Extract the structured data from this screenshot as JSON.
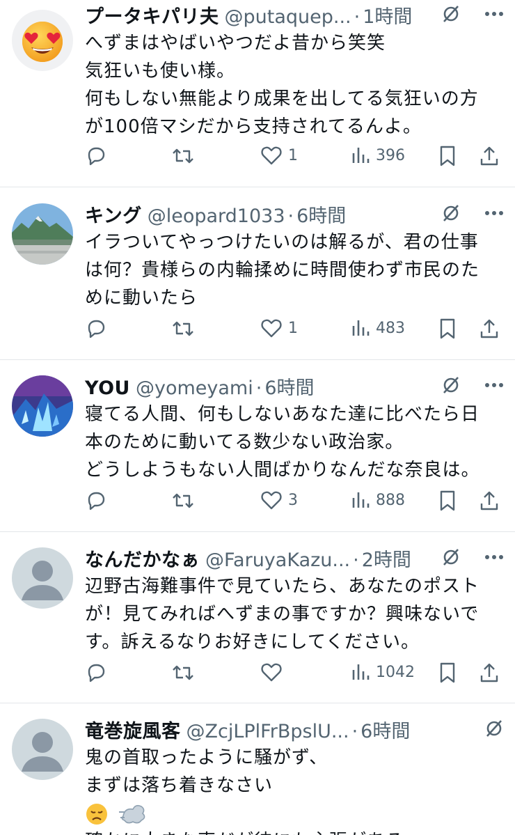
{
  "tweets": [
    {
      "name": "プータキパリ夫",
      "handle": "@putaquep...",
      "time": "1時間",
      "lines": [
        "へずまはやばいやつだよ昔から笑笑",
        "気狂いも使い様。",
        "何もしない無能より成果を出してる気狂いの方",
        "が100倍マシだから支持されてるんよ。"
      ],
      "likes": "1",
      "views": "396",
      "avatar": "heart-eyes-emoji"
    },
    {
      "name": "キング",
      "handle": "@leopard1033",
      "time": "6時間",
      "lines": [
        "イラついてやっつけたいのは解るが、君の仕事",
        "は何？貴様らの内輪揉めに時間使わず市民のた",
        "めに動いたら"
      ],
      "likes": "1",
      "views": "483",
      "avatar": "landscape-photo"
    },
    {
      "name": "YOU",
      "handle": "@yomeyami",
      "time": "6時間",
      "lines": [
        "寝てる人間、何もしないあなた達に比べたら日",
        "本のために動いてる数少ない政治家。",
        "どうしようもない人間ばかりなんだな奈良は。"
      ],
      "likes": "3",
      "views": "888",
      "avatar": "game-art"
    },
    {
      "name": "なんだかなぁ",
      "handle": "@FaruyaKazu...",
      "time": "2時間",
      "lines": [
        "辺野古海難事件で見ていたら、あなたのポスト",
        "が！見てみればへずまの事ですか？興味ないで",
        "す。訴えるなりお好きにしてください。"
      ],
      "likes": "",
      "views": "1042",
      "avatar": "default-avatar"
    },
    {
      "name": "竜巻旋風客",
      "handle": "@ZcjLPlFrBpslU...",
      "time": "6時間",
      "lines": [
        "鬼の首取ったように騒がず、",
        "まずは落ち着きなさい"
      ],
      "emoji_line": "disappointed-face, dash-symbol",
      "partial_line": "確かに大きな声だが彼にも主張がある",
      "avatar": "default-avatar"
    }
  ],
  "colors": {
    "text": "#0f1419",
    "muted": "#536471",
    "divider": "#e3e6e9"
  }
}
